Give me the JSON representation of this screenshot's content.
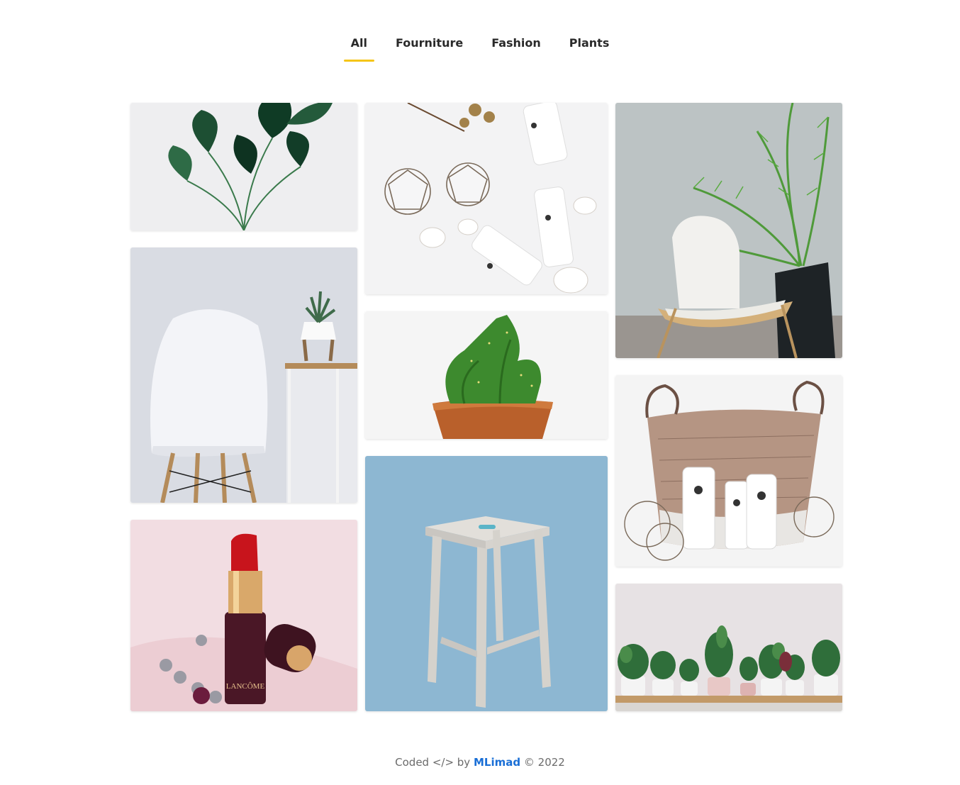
{
  "filters": {
    "tabs": [
      {
        "label": "All",
        "active": true
      },
      {
        "label": "Fourniture",
        "active": false
      },
      {
        "label": "Fashion",
        "active": false
      },
      {
        "label": "Plants",
        "active": false
      }
    ],
    "active_color": "#f5c518"
  },
  "gallery": {
    "items": [
      {
        "subject": "potted plant with heart-shaped leaves",
        "category": "Plants"
      },
      {
        "subject": "white chair beside side table with succulent",
        "category": "Fourniture"
      },
      {
        "subject": "lipstick with bracelet",
        "category": "Fashion"
      },
      {
        "subject": "ONNE cosmetic bottles with shells",
        "category": "Fashion"
      },
      {
        "subject": "cactus in terracotta pot",
        "category": "Plants"
      },
      {
        "subject": "wooden stool on blue background",
        "category": "Fourniture"
      },
      {
        "subject": "white chair with palm plant",
        "category": "Fourniture"
      },
      {
        "subject": "woven basket with ONNE bottles",
        "category": "Fashion"
      },
      {
        "subject": "row of potted house plants on shelf",
        "category": "Plants"
      }
    ]
  },
  "footer": {
    "prefix": "Coded </> by",
    "author": "MLimad",
    "suffix": "© 2022"
  }
}
